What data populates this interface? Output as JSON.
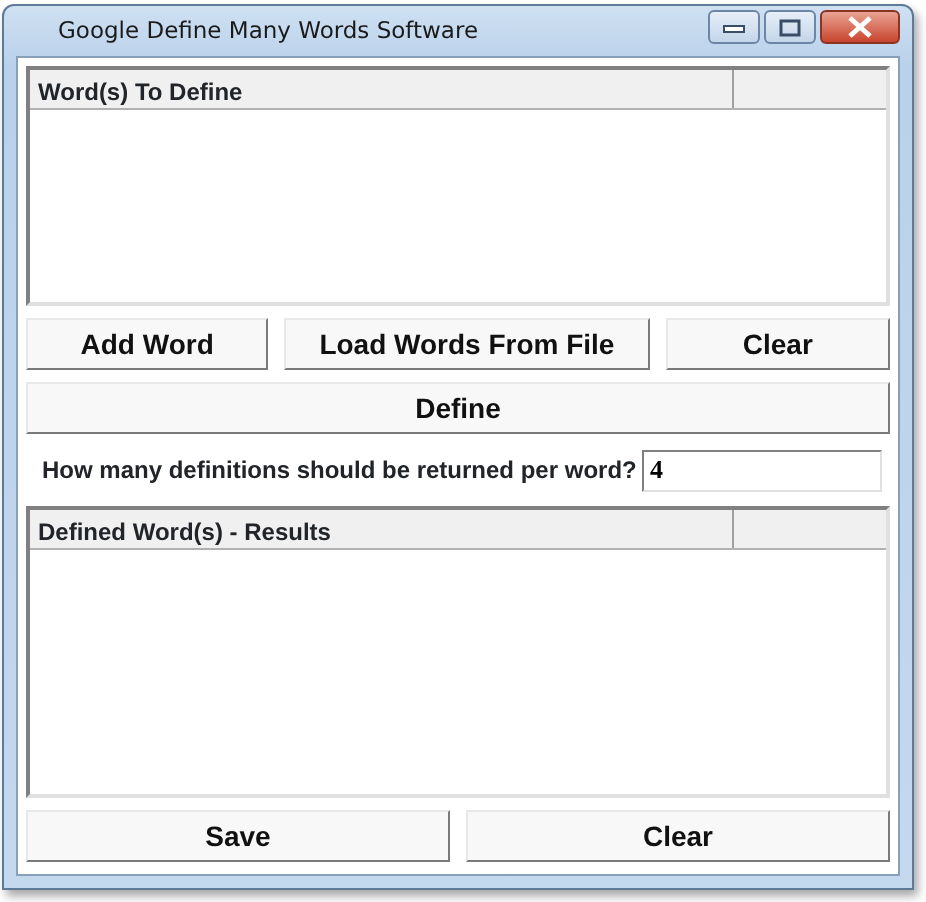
{
  "window": {
    "title": "Google Define Many Words Software"
  },
  "word_list": {
    "column_1": "Word(s) To Define"
  },
  "word_buttons": [
    "Add Word",
    "Load Words From File",
    "Clear"
  ],
  "define_button": "Define",
  "definitions_count": {
    "label": "How many definitions should be returned per word?",
    "value": "4"
  },
  "results_list": {
    "column_1": "Defined Word(s) - Results"
  },
  "bottom_buttons": [
    "Save",
    "Clear"
  ]
}
